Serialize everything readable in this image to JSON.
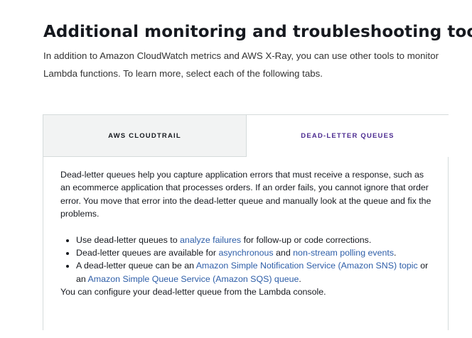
{
  "header": {
    "title": "Additional monitoring and troubleshooting tools",
    "intro": "In addition to Amazon CloudWatch metrics and AWS X-Ray, you can use other tools to monitor Lambda functions. To learn more, select each of the following tabs."
  },
  "tabs": [
    {
      "label": "AWS CLOUDTRAIL",
      "selected": false
    },
    {
      "label": "DEAD-LETTER QUEUES",
      "selected": true
    }
  ],
  "panel": {
    "intro": "Dead-letter queues help you capture application errors that must receive a response, such as an ecommerce application that processes orders. If an order fails, you cannot ignore that order error. You move that error into the dead-letter queue and manually look at the queue and fix the problems.",
    "bullets": [
      {
        "t1": "Use dead-letter queues to ",
        "l1": "analyze failures",
        "t2": " for follow-up or code corrections."
      },
      {
        "t1": "Dead-letter queues are available for ",
        "l1": "asynchronous",
        "t2": " and ",
        "l2": "non-stream polling events",
        "t3": "."
      },
      {
        "t1": "A dead-letter queue can be an ",
        "l1": "Amazon Simple Notification Service (Amazon SNS) topic",
        "t2": " or an ",
        "l2": "Amazon Simple Queue Service (Amazon SQS) queue",
        "t3": "."
      }
    ],
    "footer": "You can configure your dead-letter queue from the Lambda console."
  },
  "colors": {
    "link": "#2e5ea8",
    "selected_tab_text": "#4d2c91",
    "inactive_tab_bg": "#f2f3f3",
    "border": "#d5dbdb"
  }
}
